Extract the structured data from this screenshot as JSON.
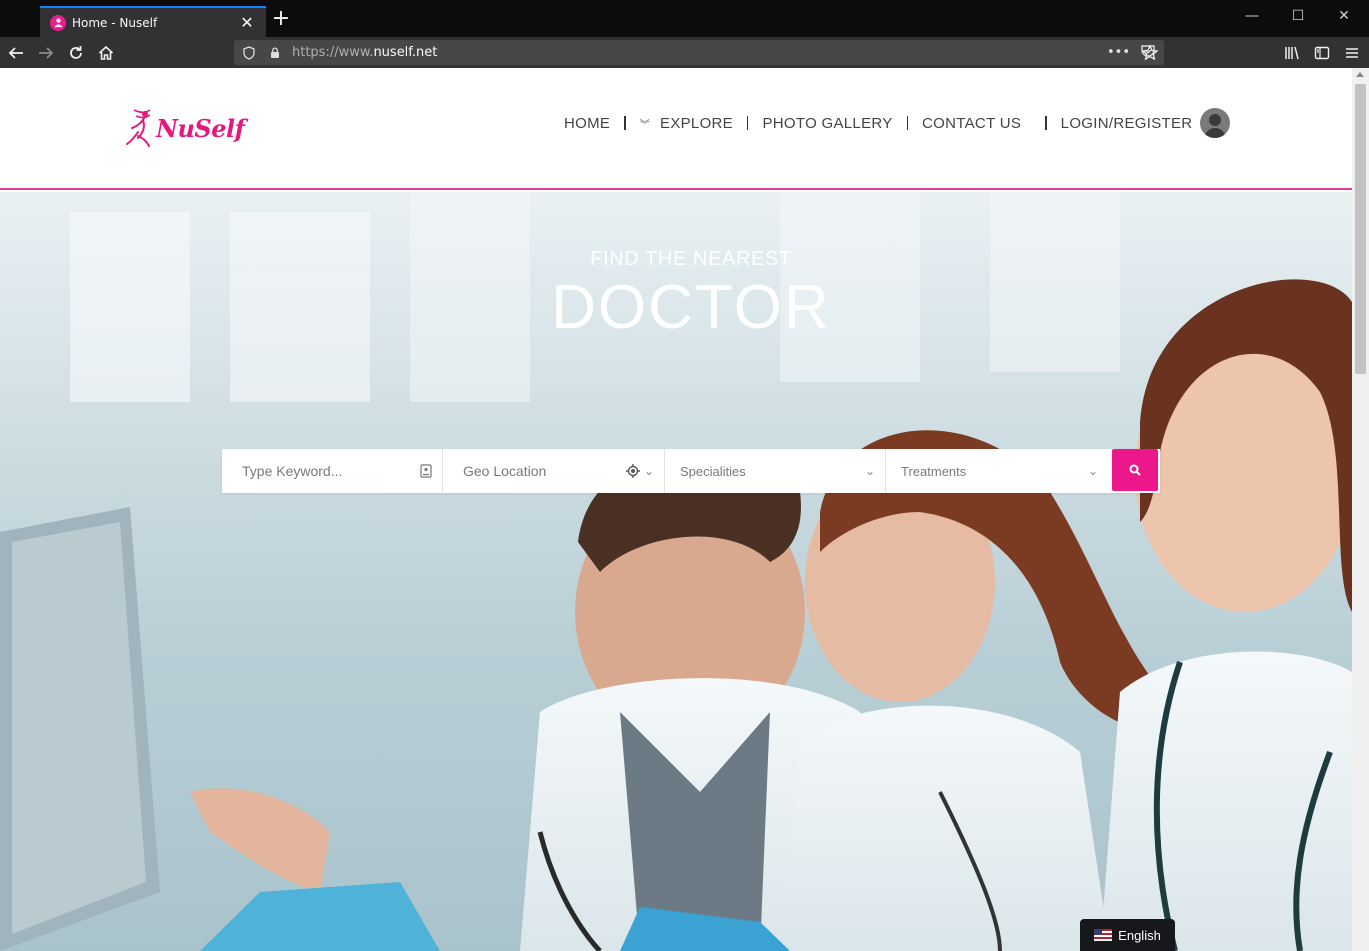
{
  "browser": {
    "tab_title": "Home - Nuself",
    "url_prefix": "https://www.",
    "url_domain": "nuself.net",
    "url_suffix": "",
    "more_label": "•••"
  },
  "site": {
    "logo_text": "NuSelf",
    "menu": {
      "home": "HOME",
      "explore": "EXPLORE",
      "gallery": "PHOTO GALLERY",
      "contact": "CONTACT US",
      "login": "LOGIN/REGISTER"
    },
    "hero": {
      "kicker": "FIND THE NEAREST",
      "title": "DOCTOR"
    },
    "search": {
      "keyword_placeholder": "Type Keyword...",
      "location_placeholder": "Geo Location",
      "specialities": "Specialities",
      "treatments": "Treatments"
    },
    "language": "English"
  },
  "colors": {
    "brand": "#e6177f",
    "accent_line": "#e33d9c",
    "tab_highlight": "#0a84ff"
  }
}
